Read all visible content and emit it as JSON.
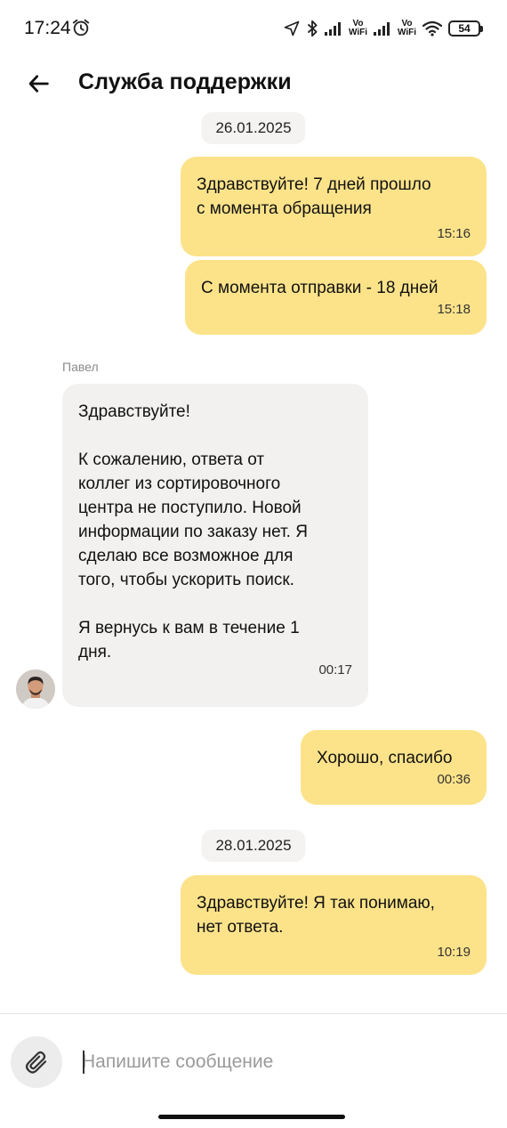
{
  "status_bar": {
    "time": "17:24",
    "vowifi_1": "Vo\nWiFi",
    "vowifi_2": "Vo\nWiFi",
    "battery": "54"
  },
  "header": {
    "title": "Служба поддержки"
  },
  "messages": {
    "date_1": "26.01.2025",
    "msg_1": {
      "text": "Здравствуйте! 7 дней прошло\nс момента обращения",
      "time": "15:16"
    },
    "msg_2": {
      "text": "С момента отправки - 18 дней",
      "time": "15:18"
    },
    "sender": "Павел",
    "msg_3": {
      "text": "Здравствуйте!\n\nК сожалению, ответа от\nколлег из сортировочного\nцентра не поступило. Новой\nинформации по заказу нет. Я\nсделаю все возможное для\nтого, чтобы ускорить поиск.\n\nЯ вернусь к вам в течение 1\nдня.",
      "time": "00:17"
    },
    "msg_4": {
      "text": "Хорошо, спасибо",
      "time": "00:36"
    },
    "date_2": "28.01.2025",
    "msg_5": {
      "text": "Здравствуйте! Я так понимаю,\nнет ответа.",
      "time": "10:19"
    }
  },
  "composer": {
    "placeholder": "Напишите сообщение"
  },
  "colors": {
    "outgoing_bubble": "#fce38a",
    "incoming_bubble": "#f2f1ef"
  }
}
